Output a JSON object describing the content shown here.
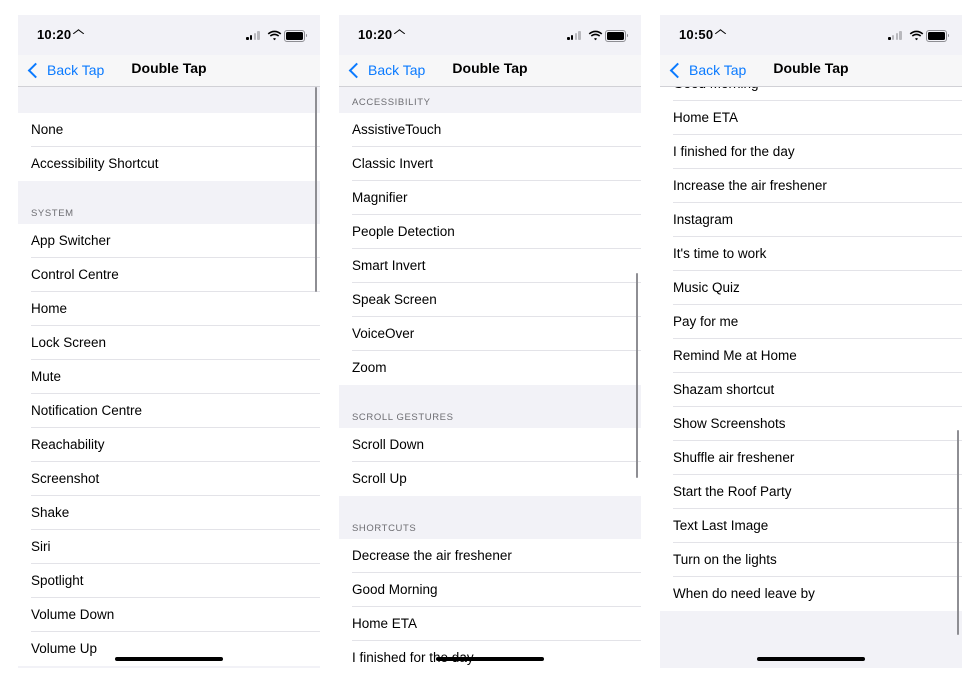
{
  "panels": [
    {
      "status": {
        "time": "10:20",
        "signal_bars": 2
      },
      "nav": {
        "back_label": "Back Tap",
        "title": "Double Tap"
      },
      "groups": [
        {
          "header": "",
          "items": [
            "None",
            "Accessibility Shortcut"
          ]
        },
        {
          "header": "SYSTEM",
          "items": [
            "App Switcher",
            "Control Centre",
            "Home",
            "Lock Screen",
            "Mute",
            "Notification Centre",
            "Reachability",
            "Screenshot",
            "Shake",
            "Siri",
            "Spotlight",
            "Volume Down",
            "Volume Up"
          ]
        }
      ]
    },
    {
      "status": {
        "time": "10:20",
        "signal_bars": 2
      },
      "nav": {
        "back_label": "Back Tap",
        "title": "Double Tap"
      },
      "groups": [
        {
          "header": "ACCESSIBILITY",
          "items": [
            "AssistiveTouch",
            "Classic Invert",
            "Magnifier",
            "People Detection",
            "Smart Invert",
            "Speak Screen",
            "VoiceOver",
            "Zoom"
          ]
        },
        {
          "header": "SCROLL GESTURES",
          "items": [
            "Scroll Down",
            "Scroll Up"
          ]
        },
        {
          "header": "SHORTCUTS",
          "items": [
            "Decrease the air freshener",
            "Good Morning",
            "Home ETA",
            "I finished for the day"
          ]
        }
      ]
    },
    {
      "status": {
        "time": "10:50",
        "signal_bars": 1
      },
      "nav": {
        "back_label": "Back Tap",
        "title": "Double Tap"
      },
      "groups": [
        {
          "header": "",
          "items": [
            "Good Morning",
            "Home ETA",
            "I finished for the day",
            "Increase the air freshener",
            "Instagram",
            "It's time to work",
            "Music Quiz",
            "Pay for me",
            "Remind Me at Home",
            "Shazam shortcut",
            "Show Screenshots",
            "Shuffle air freshener",
            "Start the Roof Party",
            "Text Last Image",
            "Turn on the lights",
            "When do need leave by"
          ]
        }
      ]
    }
  ]
}
